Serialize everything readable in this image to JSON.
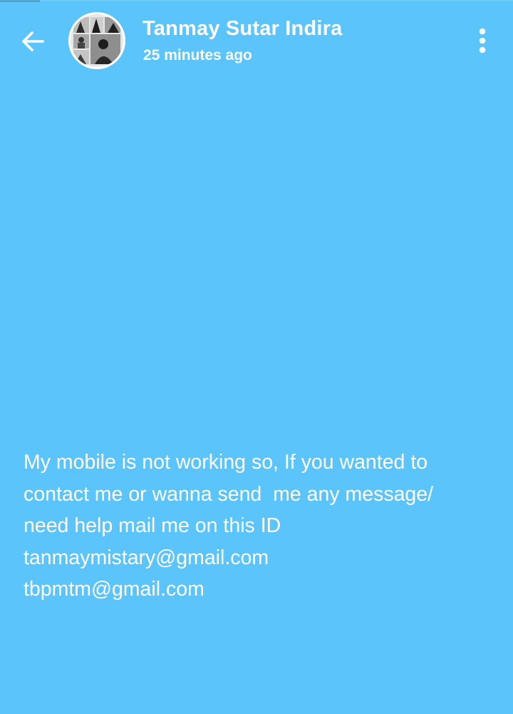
{
  "header": {
    "back_icon": "arrow-left-icon",
    "avatar_icon": "profile-photo-collage",
    "name": "Tanmay Sutar Indira",
    "time": "25 minutes ago",
    "menu_icon": "more-vertical-icon"
  },
  "story": {
    "lines": [
      "My mobile is not working so, If you wanted to",
      "contact me or wanna send  me any message/",
      "need help mail me on this ID",
      "tanmaymistary@gmail.com",
      "tbpmtm@gmail.com"
    ]
  },
  "colors": {
    "background": "#5bc5fb",
    "text": "#ffffff"
  }
}
